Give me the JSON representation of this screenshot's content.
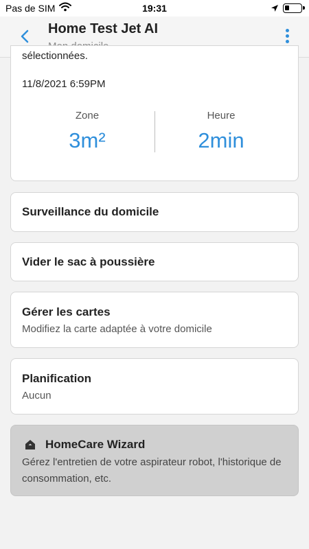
{
  "status_bar": {
    "carrier": "Pas de SIM",
    "time": "19:31"
  },
  "header": {
    "title": "Home Test Jet AI",
    "subtitle": "Mon domicile"
  },
  "history": {
    "text_line": "sélectionnées.",
    "datetime": "11/8/2021 6:59PM",
    "zone_label": "Zone",
    "zone_value": "3m²",
    "time_label": "Heure",
    "time_value": "2min"
  },
  "menu": [
    {
      "label": "Surveillance du domicile"
    },
    {
      "label": "Vider le sac à poussière"
    },
    {
      "label": "Gérer les cartes",
      "sub": "Modifiez la carte adaptée à votre domicile"
    },
    {
      "label": "Planification",
      "sub": "Aucun"
    }
  ],
  "wizard": {
    "title": "HomeCare Wizard",
    "description": "Gérez l'entretien de votre aspirateur robot, l'historique de consommation, etc."
  },
  "colors": {
    "accent": "#2f8fdb",
    "wizard_bg": "#d0d0d0"
  }
}
